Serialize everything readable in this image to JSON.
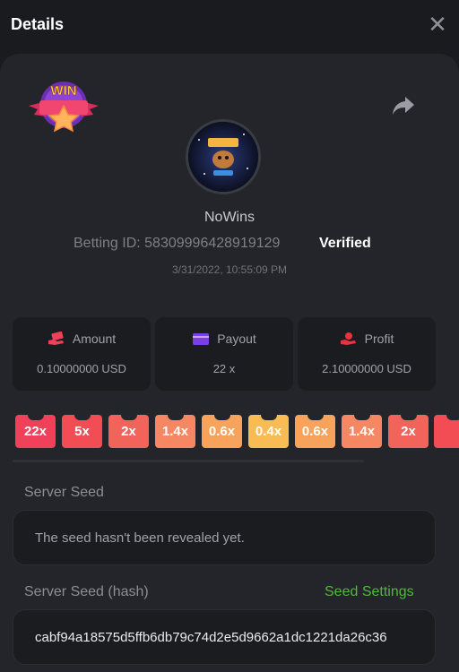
{
  "header": {
    "title": "Details"
  },
  "badge": {
    "text": "WIN"
  },
  "user": {
    "name": "NoWins",
    "bet_label": "Betting ID:",
    "bet_id": "58309996428919129",
    "verified": "Verified",
    "timestamp": "3/31/2022, 10:55:09 PM"
  },
  "stats": [
    {
      "label": "Amount",
      "value": "0.10000000 USD"
    },
    {
      "label": "Payout",
      "value": "22 x"
    },
    {
      "label": "Profit",
      "value": "2.10000000 USD"
    }
  ],
  "multipliers": [
    {
      "label": "22x",
      "color": "#f0405a"
    },
    {
      "label": "5x",
      "color": "#f24c55"
    },
    {
      "label": "2x",
      "color": "#f2635b"
    },
    {
      "label": "1.4x",
      "color": "#f58763"
    },
    {
      "label": "0.6x",
      "color": "#f7a35c"
    },
    {
      "label": "0.4x",
      "color": "#f9bc55"
    },
    {
      "label": "0.6x",
      "color": "#f7a35c"
    },
    {
      "label": "1.4x",
      "color": "#f58763"
    },
    {
      "label": "2x",
      "color": "#f2635b"
    },
    {
      "label": "",
      "color": "#f24c55"
    }
  ],
  "seed": {
    "server_label": "Server Seed",
    "server_value": "The seed hasn't been revealed yet.",
    "hash_label": "Server Seed (hash)",
    "settings_link": "Seed Settings",
    "hash_value": "cabf94a18575d5ffb6db79c74d2e5d9662a1dc1221da26c36"
  }
}
